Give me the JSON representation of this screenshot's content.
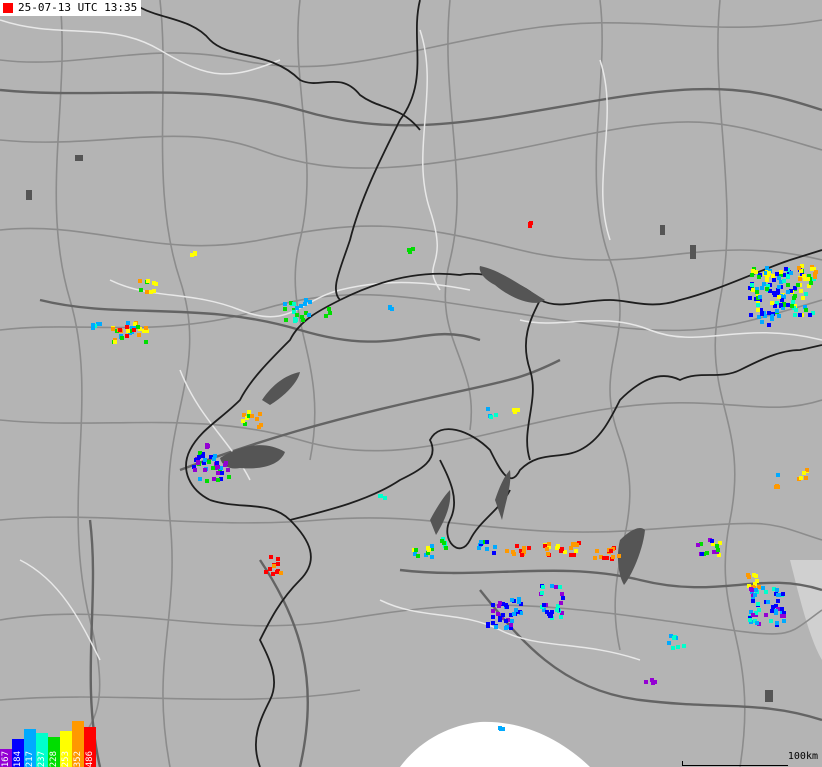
{
  "timestamp": "25-07-13 UTC 13:35",
  "timestamp_marker_color": "#ff0000",
  "legend": [
    {
      "label": "167",
      "color": "#9400d3"
    },
    {
      "label": "184",
      "color": "#0000ff"
    },
    {
      "label": "217",
      "color": "#00aaff"
    },
    {
      "label": "237",
      "color": "#00ffcc"
    },
    {
      "label": "228",
      "color": "#00dd00"
    },
    {
      "label": "253",
      "color": "#ffff00"
    },
    {
      "label": "352",
      "color": "#ff9900"
    },
    {
      "label": "486",
      "color": "#ff0000"
    }
  ],
  "scale_label": "100km",
  "colors": {
    "land": "#b4b4b4",
    "lake": "#555555",
    "sea": "#ffffff",
    "border": "#1e1e1e",
    "road": "#8c8c8c",
    "river": "#e6e6e6"
  }
}
